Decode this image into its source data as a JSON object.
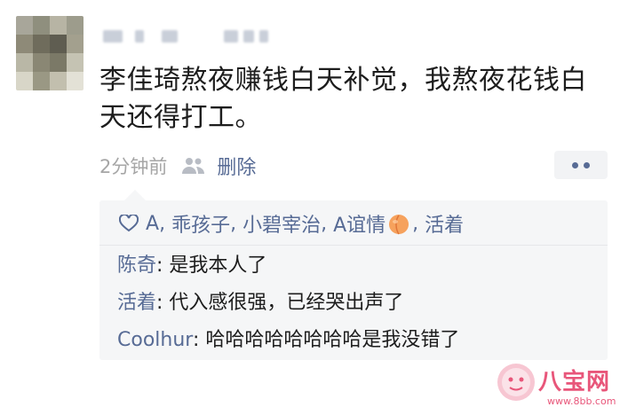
{
  "post": {
    "text": "李佳琦熬夜赚钱白天补觉，我熬夜花钱白天还得打工。",
    "time": "2分钟前",
    "delete_label": "删除"
  },
  "likes": {
    "names": [
      "A",
      "乖孩子",
      "小碧宰治",
      "A谊情",
      "活着"
    ]
  },
  "comments": [
    {
      "author": "陈奇",
      "text": "是我本人了"
    },
    {
      "author": "活着",
      "text": "代入感很强，已经哭出声了"
    },
    {
      "author": "Coolhur",
      "text": "哈哈哈哈哈哈哈哈是我没错了"
    }
  ],
  "watermark": {
    "brand": "八宝网",
    "url": "www.8bb.com"
  },
  "colors": {
    "link": "#576b95",
    "text": "#1d1d1d",
    "meta": "#a6a6a6",
    "comment_bg": "#f5f6f7",
    "watermark": "#e8567a"
  }
}
